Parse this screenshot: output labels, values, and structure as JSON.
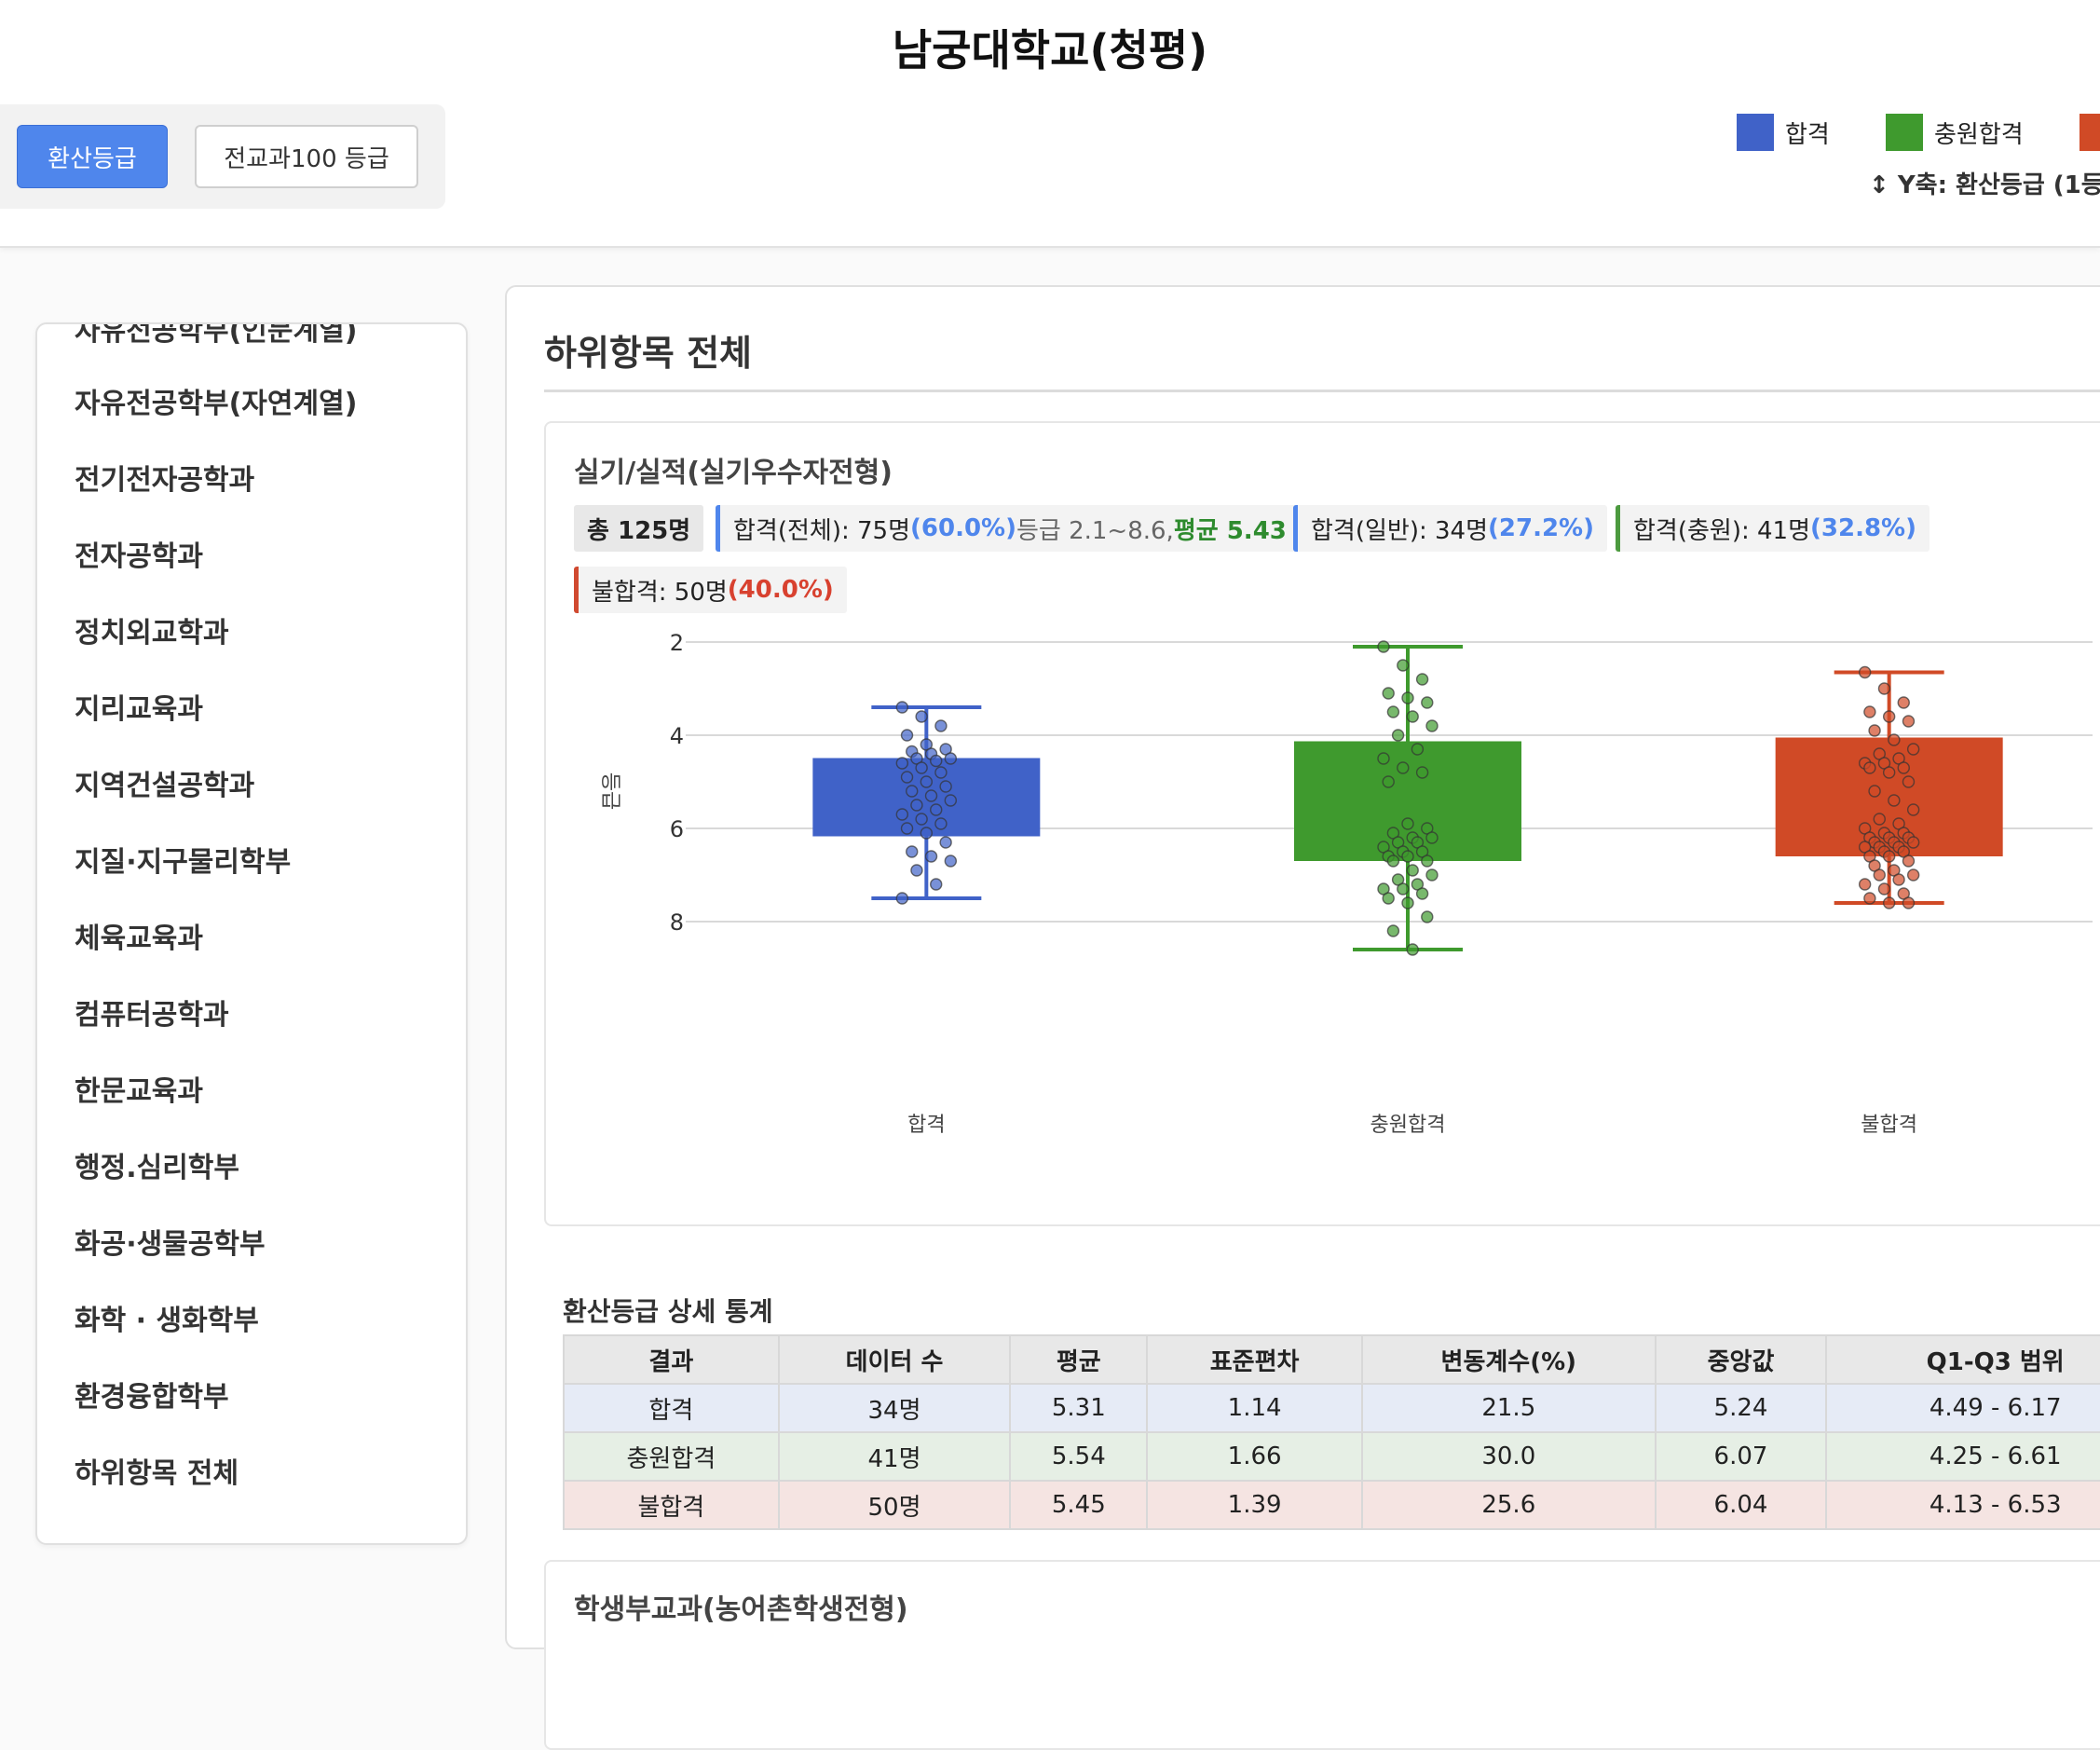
{
  "header": {
    "title": "남궁대학교(청평)",
    "buttons": [
      "환산등급",
      "전교과100 등급"
    ],
    "legend": [
      {
        "label": "합격",
        "color": "#4062c8"
      },
      {
        "label": "충원합격",
        "color": "#3f9a2e"
      },
      {
        "label": "",
        "color": "#d04a26"
      }
    ],
    "axis_note": "Y축: 환산등급 (1등"
  },
  "sidebar": {
    "items": [
      "자유전공학부(인문계열)",
      "자유전공학부(자연계열)",
      "전기전자공학과",
      "전자공학과",
      "정치외교학과",
      "지리교육과",
      "지역건설공학과",
      "지질·지구물리학부",
      "체육교육과",
      "컴퓨터공학과",
      "한문교육과",
      "행정.심리학부",
      "화공·생물공학부",
      "화학 · 생화학부",
      "환경융합학부",
      "하위항목 전체"
    ]
  },
  "main": {
    "title": "하위항목 전체",
    "section": {
      "title": "실기/실적(실기우수자전형)",
      "badges": {
        "total": "총 125명",
        "pass_all": {
          "label": "합격(전체): 75명 ",
          "pct": "(60.0%)",
          "range": " 등급 2.1~8.6, ",
          "avg": "평균 5.43"
        },
        "pass_general": {
          "label": "합격(일반): 34명 ",
          "pct": "(27.2%)"
        },
        "pass_extra": {
          "label": "합격(충원): 41명 ",
          "pct": "(32.8%)"
        },
        "fail": {
          "label": "불합격: 50명 ",
          "pct": "(40.0%)"
        }
      }
    },
    "stats": {
      "title": "환산등급 상세 통계",
      "headers": [
        "결과",
        "데이터 수",
        "평균",
        "표준편차",
        "변동계수(%)",
        "중앙값",
        "Q1-Q3 범위"
      ],
      "rows": [
        [
          "합격",
          "34명",
          "5.31",
          "1.14",
          "21.5",
          "5.24",
          "4.49 - 6.17"
        ],
        [
          "충원합격",
          "41명",
          "5.54",
          "1.66",
          "30.0",
          "6.07",
          "4.25 - 6.61"
        ],
        [
          "불합격",
          "50명",
          "5.45",
          "1.39",
          "25.6",
          "6.04",
          "4.13 - 6.53"
        ]
      ]
    },
    "next_section_title": "학생부교과(농어촌학생전형)"
  },
  "chart_data": {
    "type": "box",
    "title": "",
    "xlabel": "",
    "ylabel": "등급",
    "ylim": [
      1.7,
      8.7
    ],
    "y_reversed": true,
    "yticks": [
      2,
      4,
      6,
      8
    ],
    "categories": [
      "합격",
      "충원합격",
      "불합격"
    ],
    "colors": [
      "#4062c8",
      "#3f9a2e",
      "#d04a26"
    ],
    "boxes": [
      {
        "name": "합격",
        "q1": 4.49,
        "q3": 6.17,
        "whisker_low": 3.4,
        "whisker_high": 7.5
      },
      {
        "name": "충원합격",
        "q1": 4.13,
        "q3": 6.7,
        "whisker_low": 2.1,
        "whisker_high": 8.6
      },
      {
        "name": "불합격",
        "q1": 4.05,
        "q3": 6.6,
        "whisker_low": 2.65,
        "whisker_high": 7.6
      }
    ],
    "points": [
      [
        3.4,
        3.6,
        3.8,
        4.0,
        4.2,
        4.3,
        4.35,
        4.4,
        4.5,
        4.5,
        4.55,
        4.6,
        4.7,
        4.8,
        4.9,
        5.0,
        5.1,
        5.2,
        5.3,
        5.4,
        5.5,
        5.6,
        5.7,
        5.8,
        5.9,
        6.0,
        6.1,
        6.3,
        6.5,
        6.6,
        6.7,
        6.9,
        7.2,
        7.5
      ],
      [
        2.1,
        2.5,
        2.8,
        3.1,
        3.2,
        3.3,
        3.5,
        3.6,
        3.8,
        4.0,
        4.3,
        4.5,
        4.7,
        4.8,
        5.0,
        5.9,
        6.0,
        6.1,
        6.2,
        6.2,
        6.3,
        6.3,
        6.4,
        6.5,
        6.5,
        6.6,
        6.6,
        6.7,
        6.7,
        6.9,
        7.0,
        7.1,
        7.2,
        7.3,
        7.3,
        7.4,
        7.5,
        7.6,
        7.9,
        8.2,
        8.6
      ],
      [
        2.65,
        3.0,
        3.3,
        3.5,
        3.6,
        3.7,
        3.9,
        4.1,
        4.3,
        4.4,
        4.5,
        4.6,
        4.6,
        4.7,
        4.7,
        4.8,
        5.0,
        5.2,
        5.4,
        5.6,
        5.8,
        5.9,
        6.0,
        6.1,
        6.1,
        6.2,
        6.2,
        6.2,
        6.3,
        6.3,
        6.3,
        6.4,
        6.4,
        6.4,
        6.5,
        6.5,
        6.6,
        6.6,
        6.7,
        6.8,
        6.9,
        7.0,
        7.0,
        7.1,
        7.2,
        7.3,
        7.4,
        7.5,
        7.6,
        7.6
      ]
    ]
  }
}
